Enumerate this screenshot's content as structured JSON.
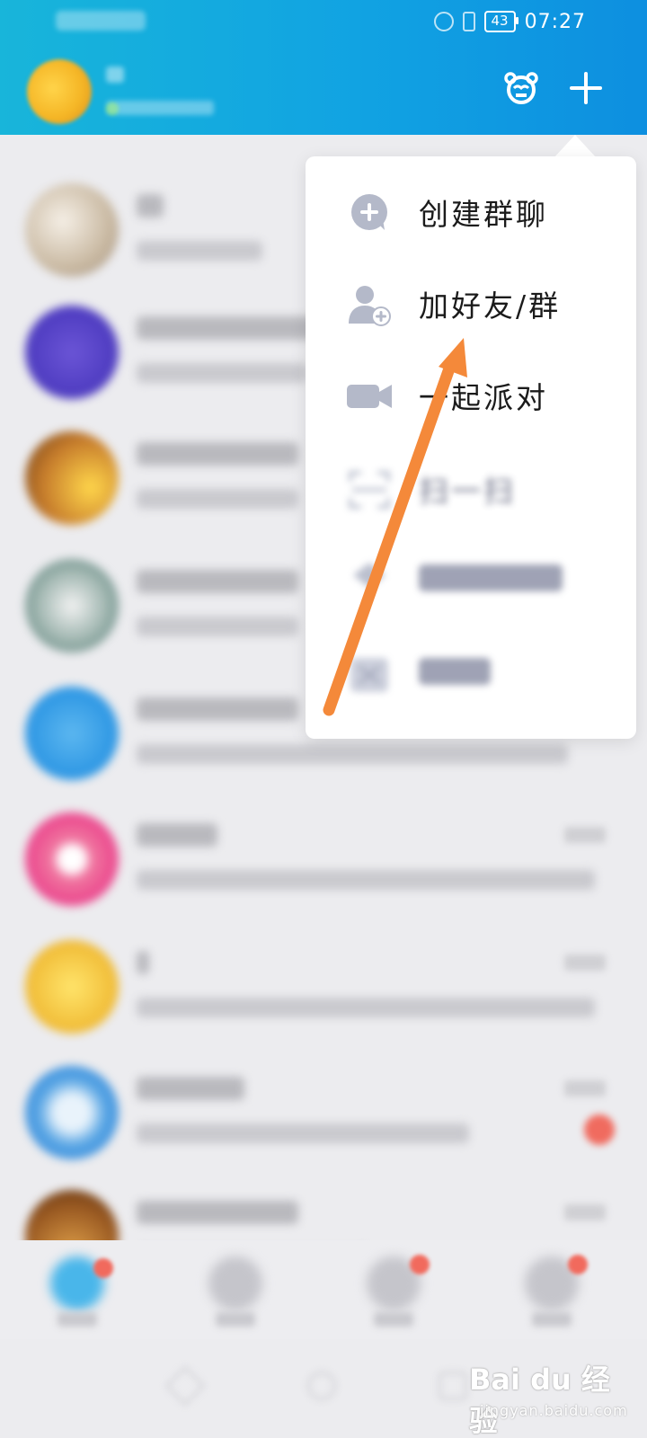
{
  "status_bar": {
    "battery": "43",
    "time": "07:27"
  },
  "header": {
    "party_icon": "party-mascot-icon",
    "add_icon": "plus-icon"
  },
  "menu": {
    "items": [
      {
        "label": "创建群聊",
        "icon": "create-group-chat-icon"
      },
      {
        "label": "加好友/群",
        "icon": "add-friend-icon"
      },
      {
        "label": "一起派对",
        "icon": "party-video-icon"
      },
      {
        "label": "扫一扫",
        "icon": "scan-icon"
      },
      {
        "label": "",
        "icon": "face-to-face-icon"
      },
      {
        "label": "",
        "icon": "payment-icon"
      }
    ]
  },
  "annotation": {
    "arrow_color": "#f4893a",
    "target": "加好友/群"
  },
  "colors": {
    "header_start": "#18b5da",
    "header_end": "#0d8fe0",
    "menu_background": "#ffffff",
    "page_background": "#ececef"
  },
  "watermark": {
    "text": "Bai du 经验",
    "subtext": "jingyan.baidu.com"
  }
}
